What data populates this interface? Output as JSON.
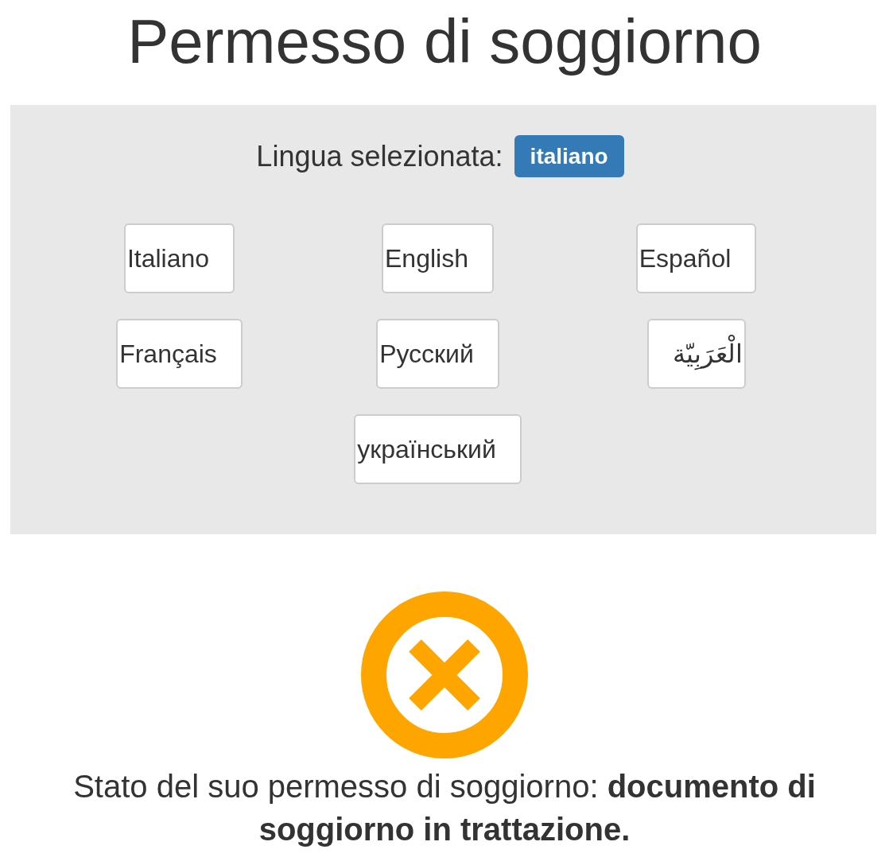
{
  "title": "Permesso di soggiorno",
  "language_panel": {
    "label": "Lingua selezionata:",
    "selected_badge": "italiano",
    "languages": [
      {
        "label": "Italiano"
      },
      {
        "label": "English"
      },
      {
        "label": "Español"
      },
      {
        "label": "Français"
      },
      {
        "label": "Русский"
      },
      {
        "label": "الْعَرَبِيّة"
      },
      {
        "label": "український"
      }
    ]
  },
  "status": {
    "kind": "pending",
    "message": "Stato del suo permesso di soggiorno: **documento di soggiorno in trattazione.**"
  }
}
